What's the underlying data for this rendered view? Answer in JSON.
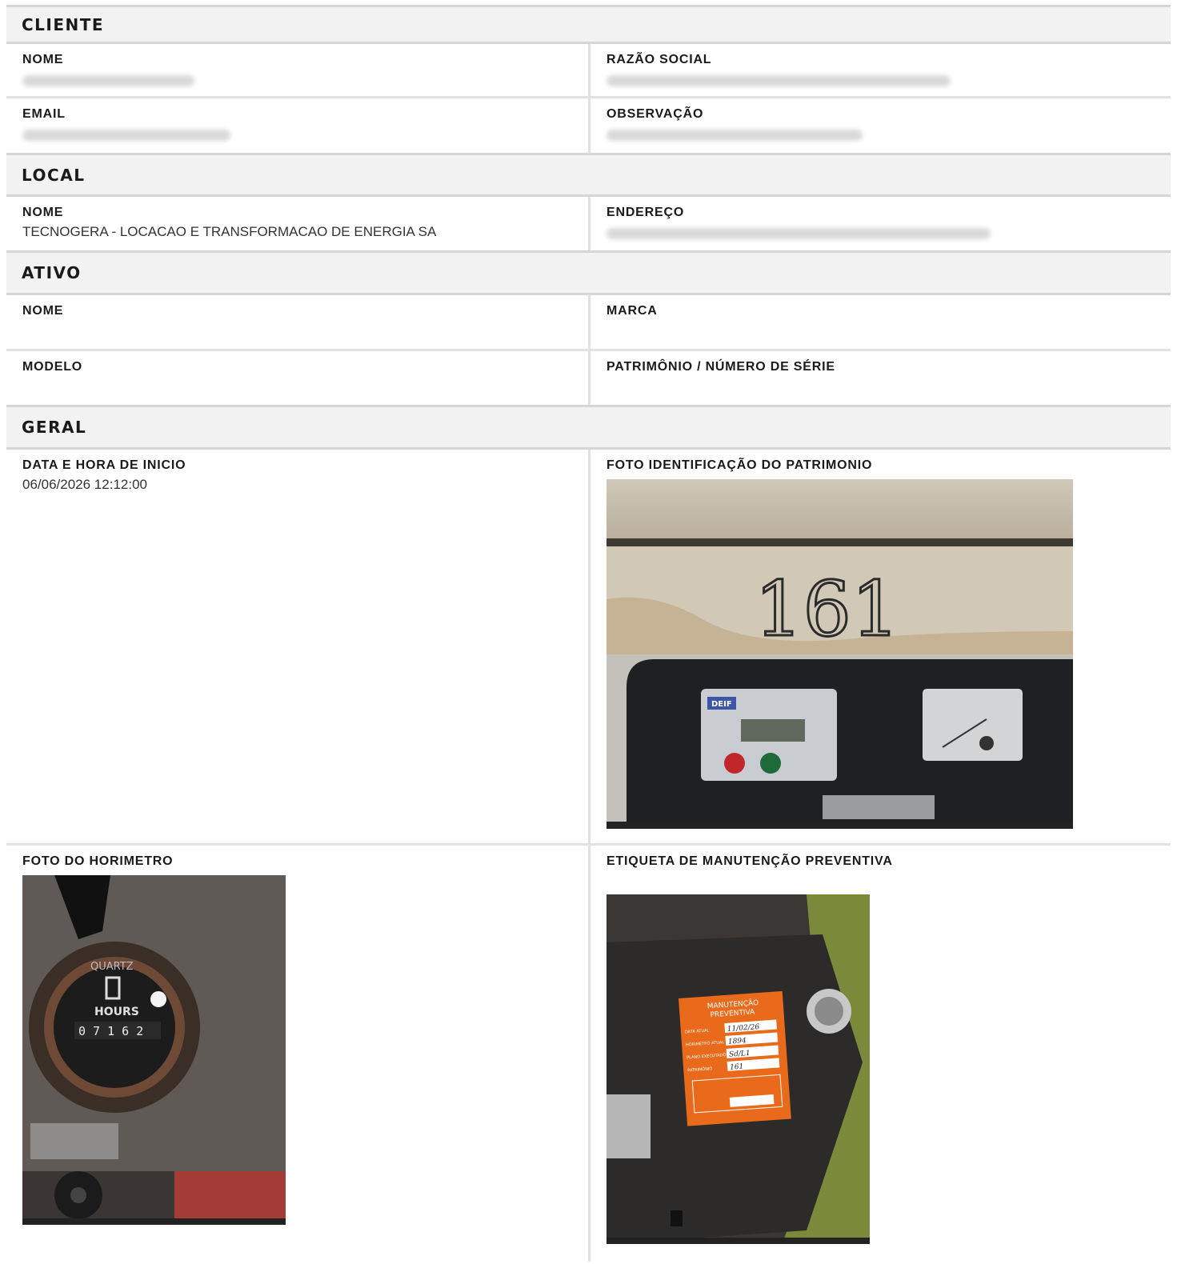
{
  "sections": {
    "cliente": {
      "title": "CLIENTE",
      "nome_label": "NOME",
      "razao_label": "RAZÃO SOCIAL",
      "email_label": "EMAIL",
      "obs_label": "OBSERVAÇÃO"
    },
    "local": {
      "title": "LOCAL",
      "nome_label": "NOME",
      "nome_value": "TECNOGERA - LOCACAO E TRANSFORMACAO DE ENERGIA SA",
      "endereco_label": "ENDEREÇO"
    },
    "ativo": {
      "title": "ATIVO",
      "nome_label": "NOME",
      "marca_label": "MARCA",
      "modelo_label": "MODELO",
      "patrimonio_label": "PATRIMÔNIO / NÚMERO DE SÉRIE"
    },
    "geral": {
      "title": "GERAL",
      "inicio_label": "DATA E HORA DE INICIO",
      "inicio_value": "06/06/2026 12:12:00",
      "foto_patrimonio_label": "FOTO IDENTIFICAÇÃO DO PATRIMONIO",
      "foto_horimetro_label": "FOTO DO HORIMETRO",
      "etiqueta_label": "ETIQUETA DE MANUTENÇÃO PREVENTIVA"
    }
  },
  "photos": {
    "patrimonio_number": "161",
    "panel_brand": "DEIF",
    "horimetro_brand": "QUARTZ",
    "horimetro_unit": "HOURS",
    "horimetro_reading": "0 7 1 6 2",
    "etiqueta_title_1": "MANUTENÇÃO",
    "etiqueta_title_2": "PREVENTIVA",
    "etiqueta_f1_label": "DATA ATUAL",
    "etiqueta_f1_value": "11/02/26",
    "etiqueta_f2_label": "HORIMETRO ATUAL",
    "etiqueta_f2_value": "1894",
    "etiqueta_f3_label": "PLANO EXECUTADO",
    "etiqueta_f3_value": "Sd/L1",
    "etiqueta_f4_label": "PATRIMÔNIO",
    "etiqueta_f4_value": "161",
    "colors": {
      "section_bg": "#f2f2f2",
      "border": "#e2e2e2",
      "label_orange": "#e86a1a"
    }
  }
}
